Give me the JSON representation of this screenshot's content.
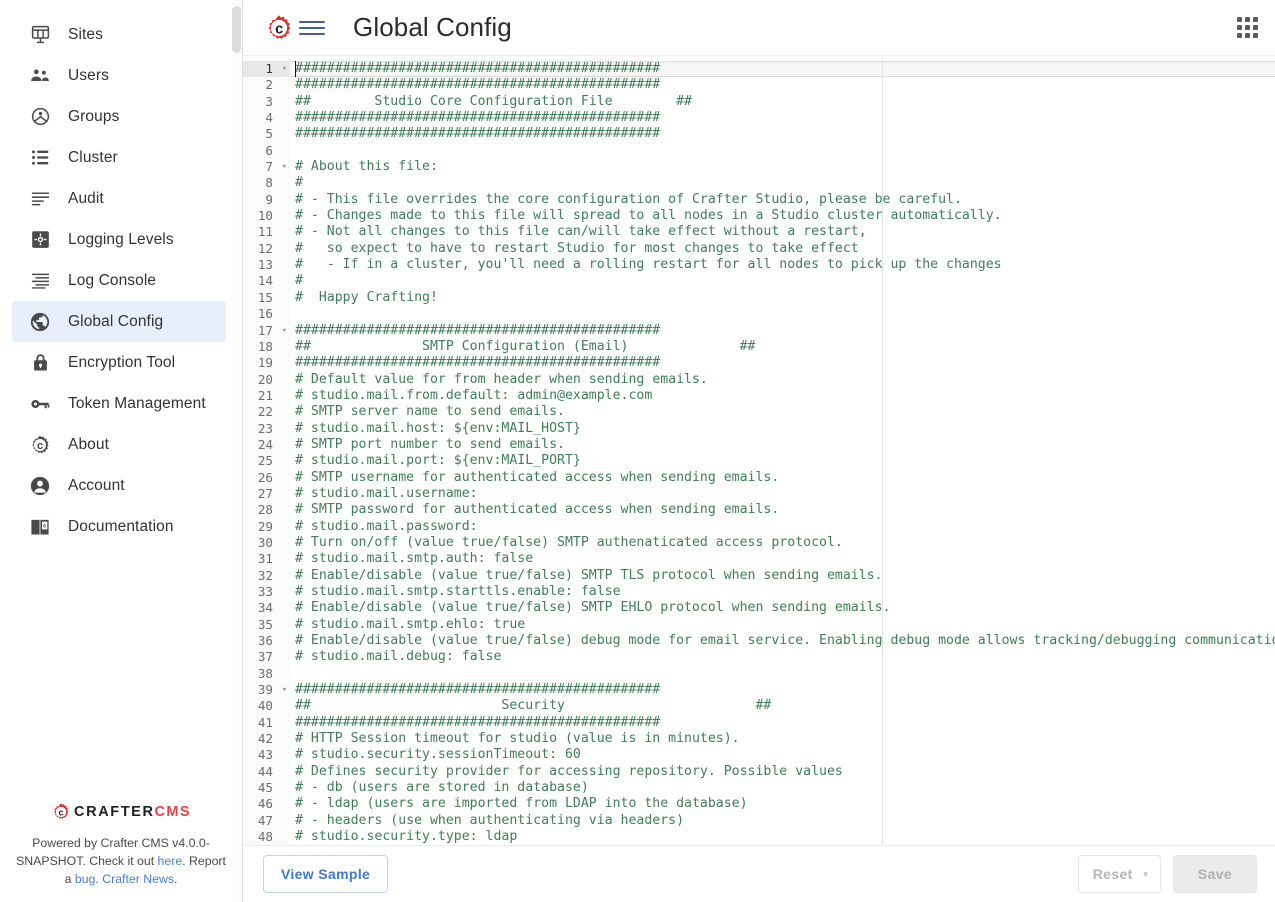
{
  "sidebar": {
    "items": [
      {
        "label": "Sites",
        "icon": "sites-icon",
        "active": false
      },
      {
        "label": "Users",
        "icon": "users-icon",
        "active": false
      },
      {
        "label": "Groups",
        "icon": "groups-icon",
        "active": false
      },
      {
        "label": "Cluster",
        "icon": "cluster-icon",
        "active": false
      },
      {
        "label": "Audit",
        "icon": "audit-icon",
        "active": false
      },
      {
        "label": "Logging Levels",
        "icon": "logging-levels-icon",
        "active": false
      },
      {
        "label": "Log Console",
        "icon": "log-console-icon",
        "active": false
      },
      {
        "label": "Global Config",
        "icon": "globe-icon",
        "active": true
      },
      {
        "label": "Encryption Tool",
        "icon": "lock-icon",
        "active": false
      },
      {
        "label": "Token Management",
        "icon": "key-icon",
        "active": false
      },
      {
        "label": "About",
        "icon": "gear-c-icon",
        "active": false
      },
      {
        "label": "Account",
        "icon": "account-icon",
        "active": false
      },
      {
        "label": "Documentation",
        "icon": "book-icon",
        "active": false
      }
    ],
    "footer": {
      "logo_primary": "CRAFTER",
      "logo_secondary": "CMS",
      "text_1": "Powered by Crafter CMS v4.0.0-SNAPSHOT. Check it out ",
      "link_here": "here",
      "text_2": ". Report a ",
      "link_bug": "bug",
      "text_3": ". ",
      "link_news": "Crafter News",
      "text_4": "."
    }
  },
  "header": {
    "title": "Global Config",
    "logo_icon": "crafter-gear-icon",
    "menu_icon": "hamburger-menu-icon",
    "apps_icon": "apps-grid-icon"
  },
  "editor": {
    "active_line": 1,
    "fold_lines": [
      1,
      7,
      17,
      39
    ],
    "lines": [
      "##############################################",
      "##############################################",
      "##        Studio Core Configuration File        ##",
      "##############################################",
      "##############################################",
      "",
      "# About this file:",
      "#",
      "# - This file overrides the core configuration of Crafter Studio, please be careful.",
      "# - Changes made to this file will spread to all nodes in a Studio cluster automatically.",
      "# - Not all changes to this file can/will take effect without a restart,",
      "#   so expect to have to restart Studio for most changes to take effect",
      "#   - If in a cluster, you'll need a rolling restart for all nodes to pick up the changes",
      "#",
      "#  Happy Crafting!",
      "",
      "##############################################",
      "##              SMTP Configuration (Email)              ##",
      "##############################################",
      "# Default value for from header when sending emails.",
      "# studio.mail.from.default: admin@example.com",
      "# SMTP server name to send emails.",
      "# studio.mail.host: ${env:MAIL_HOST}",
      "# SMTP port number to send emails.",
      "# studio.mail.port: ${env:MAIL_PORT}",
      "# SMTP username for authenticated access when sending emails.",
      "# studio.mail.username:",
      "# SMTP password for authenticated access when sending emails.",
      "# studio.mail.password:",
      "# Turn on/off (value true/false) SMTP authenaticated access protocol.",
      "# studio.mail.smtp.auth: false",
      "# Enable/disable (value true/false) SMTP TLS protocol when sending emails.",
      "# studio.mail.smtp.starttls.enable: false",
      "# Enable/disable (value true/false) SMTP EHLO protocol when sending emails.",
      "# studio.mail.smtp.ehlo: true",
      "# Enable/disable (value true/false) debug mode for email service. Enabling debug mode allows tracking/debugging communication between",
      "# studio.mail.debug: false",
      "",
      "##############################################",
      "##                        Security                        ##",
      "##############################################",
      "# HTTP Session timeout for studio (value is in minutes).",
      "# studio.security.sessionTimeout: 60",
      "# Defines security provider for accessing repository. Possible values",
      "# - db (users are stored in database)",
      "# - ldap (users are imported from LDAP into the database)",
      "# - headers (use when authenticating via headers)",
      "# studio.security.type: ldap"
    ]
  },
  "bottombar": {
    "view_sample_label": "View Sample",
    "reset_label": "Reset",
    "save_label": "Save"
  },
  "colors": {
    "accent_blue": "#3e7ad1",
    "active_nav_bg": "#e7effb",
    "code_green": "#3f7d5b",
    "brand_red": "#e9404a"
  }
}
